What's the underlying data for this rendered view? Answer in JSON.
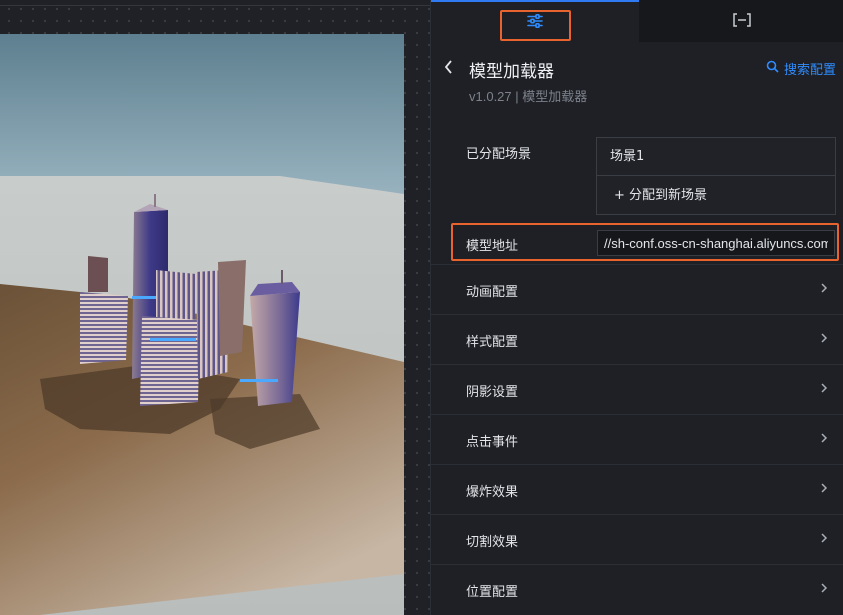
{
  "tabs": [
    {
      "name": "settings",
      "icon": "sliders-icon",
      "active": true
    },
    {
      "name": "interaction",
      "icon": "bracket-collapse-icon",
      "label": "[–]"
    }
  ],
  "header": {
    "title": "模型加载器",
    "version": "v1.0.27 | 模型加载器",
    "search_label": "搜索配置"
  },
  "assigned_scene": {
    "label": "已分配场景",
    "items": [
      "场景1"
    ],
    "add_label": "+ 分配到新场景"
  },
  "model_url": {
    "label": "模型地址",
    "value": "//sh-conf.oss-cn-shanghai.aliyuncs.com"
  },
  "sections": [
    "动画配置",
    "样式配置",
    "阴影设置",
    "点击事件",
    "爆炸效果",
    "切割效果",
    "位置配置"
  ],
  "colors": {
    "accent": "#2f7bf4",
    "highlight": "#e8632d",
    "link": "#2f8cff"
  }
}
